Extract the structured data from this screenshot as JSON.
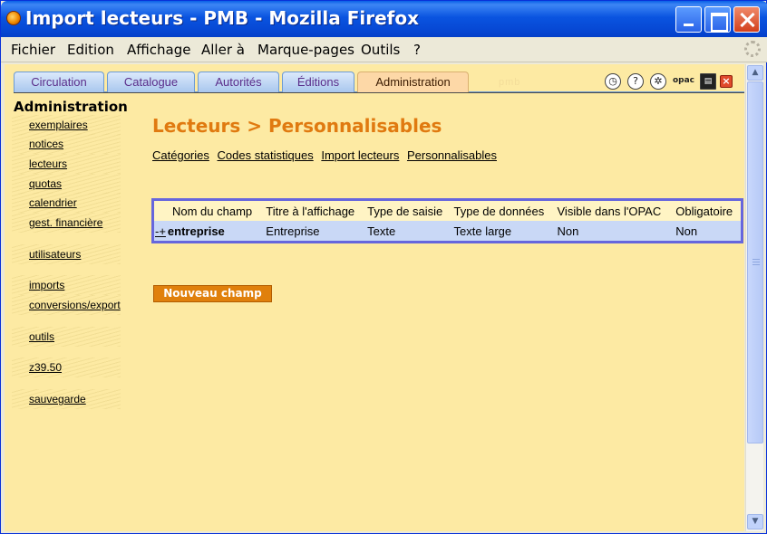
{
  "window": {
    "title": "Import lecteurs - PMB - Mozilla Firefox"
  },
  "menubar": {
    "items": [
      "Fichier",
      "Edition",
      "Affichage",
      "Aller à",
      "Marque-pages",
      "Outils",
      "?"
    ]
  },
  "tabs": [
    {
      "label": "Circulation",
      "active": false
    },
    {
      "label": "Catalogue",
      "active": false
    },
    {
      "label": "Autorités",
      "active": false
    },
    {
      "label": "Éditions",
      "active": false
    },
    {
      "label": "Administration",
      "active": true
    }
  ],
  "toolbar_icons": [
    "clock-icon",
    "help-icon",
    "gear-icon",
    "opac-icon",
    "save-icon",
    "close-icon"
  ],
  "toolbar_labels": {
    "opac": "opac"
  },
  "watermark": "pmb",
  "sidebar": {
    "title": "Administration",
    "items": [
      "exemplaires",
      "notices",
      "lecteurs",
      "quotas",
      "calendrier",
      "gest. financière",
      "utilisateurs",
      "imports",
      "conversions/export",
      "outils",
      "z39.50",
      "sauvegarde"
    ]
  },
  "main": {
    "title": "Lecteurs > Personnalisables",
    "sublinks": [
      "Catégories",
      "Codes statistiques",
      "Import lecteurs",
      "Personnalisables"
    ],
    "table": {
      "headers": [
        "Nom du champ",
        "Titre à l'affichage",
        "Type de saisie",
        "Type de données",
        "Visible dans l'OPAC",
        "Obligatoire"
      ],
      "rows": [
        {
          "expand": "-+",
          "name": "entreprise",
          "title": "Entreprise",
          "input_type": "Texte",
          "data_type": "Texte large",
          "visible": "Non",
          "required": "Non"
        }
      ]
    },
    "new_button": "Nouveau champ"
  },
  "colors": {
    "content_bg": "#fdeaa3",
    "title_accent": "#e07a10",
    "button_bg": "#e0800c",
    "table_border": "#6666dd",
    "row_highlight": "#c9d8f6"
  }
}
